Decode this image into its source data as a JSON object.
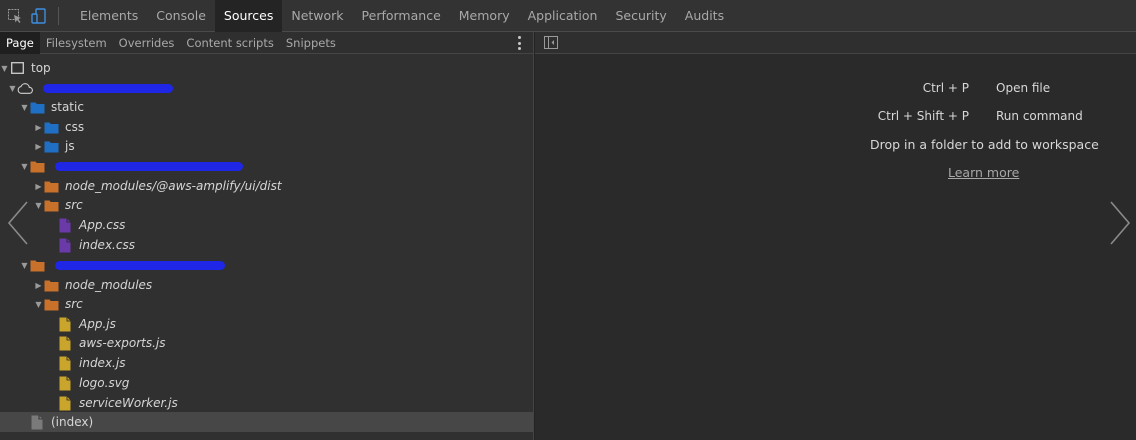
{
  "toolbar": {
    "tabs": [
      "Elements",
      "Console",
      "Sources",
      "Network",
      "Performance",
      "Memory",
      "Application",
      "Security",
      "Audits"
    ],
    "active_tab": "Sources"
  },
  "navigator": {
    "tabs": [
      "Page",
      "Filesystem",
      "Overrides",
      "Content scripts",
      "Snippets"
    ],
    "active_tab": "Page"
  },
  "tree": {
    "items": [
      {
        "label": "top",
        "kind": "frame",
        "depth": 0,
        "expanded": true,
        "italic": false
      },
      {
        "label": "",
        "kind": "domain",
        "depth": 1,
        "expanded": true,
        "italic": false,
        "redacted": true
      },
      {
        "label": "static",
        "kind": "folder-blue",
        "depth": 2,
        "expanded": true,
        "italic": false
      },
      {
        "label": "css",
        "kind": "folder-blue",
        "depth": 3,
        "expanded": false,
        "italic": false
      },
      {
        "label": "js",
        "kind": "folder-blue",
        "depth": 3,
        "expanded": false,
        "italic": false
      },
      {
        "label": "",
        "kind": "folder-orange",
        "depth": 2,
        "expanded": true,
        "italic": false,
        "redacted": true
      },
      {
        "label": "node_modules/@aws-amplify/ui/dist",
        "kind": "folder-orange",
        "depth": 3,
        "expanded": false,
        "italic": true
      },
      {
        "label": "src",
        "kind": "folder-orange",
        "depth": 3,
        "expanded": true,
        "italic": true
      },
      {
        "label": "App.css",
        "kind": "file-purple",
        "depth": 4,
        "italic": true
      },
      {
        "label": "index.css",
        "kind": "file-purple",
        "depth": 4,
        "italic": true
      },
      {
        "label": "",
        "kind": "folder-orange",
        "depth": 2,
        "expanded": true,
        "italic": false,
        "redacted": true
      },
      {
        "label": "node_modules",
        "kind": "folder-orange",
        "depth": 3,
        "expanded": false,
        "italic": true
      },
      {
        "label": "src",
        "kind": "folder-orange",
        "depth": 3,
        "expanded": true,
        "italic": true
      },
      {
        "label": "App.js",
        "kind": "file-yellow",
        "depth": 4,
        "italic": true
      },
      {
        "label": "aws-exports.js",
        "kind": "file-yellow",
        "depth": 4,
        "italic": true
      },
      {
        "label": "index.js",
        "kind": "file-yellow",
        "depth": 4,
        "italic": true
      },
      {
        "label": "logo.svg",
        "kind": "file-yellow",
        "depth": 4,
        "italic": true
      },
      {
        "label": "serviceWorker.js",
        "kind": "file-yellow",
        "depth": 4,
        "italic": true
      },
      {
        "label": "(index)",
        "kind": "file-gray",
        "depth": 2,
        "italic": false,
        "selected": true
      }
    ]
  },
  "editor_placeholder": {
    "shortcuts": [
      {
        "keys": "Ctrl + P",
        "action": "Open file"
      },
      {
        "keys": "Ctrl + Shift + P",
        "action": "Run command"
      }
    ],
    "drop_message": "Drop in a folder to add to workspace",
    "learn_more": "Learn more"
  },
  "colors": {
    "folder_blue": "#1f6fc4",
    "folder_orange": "#c7712b",
    "file_purple": "#6a3aa8",
    "file_yellow": "#c9a52c",
    "file_gray": "#7a7a7a",
    "redaction": "#1f26e6"
  }
}
